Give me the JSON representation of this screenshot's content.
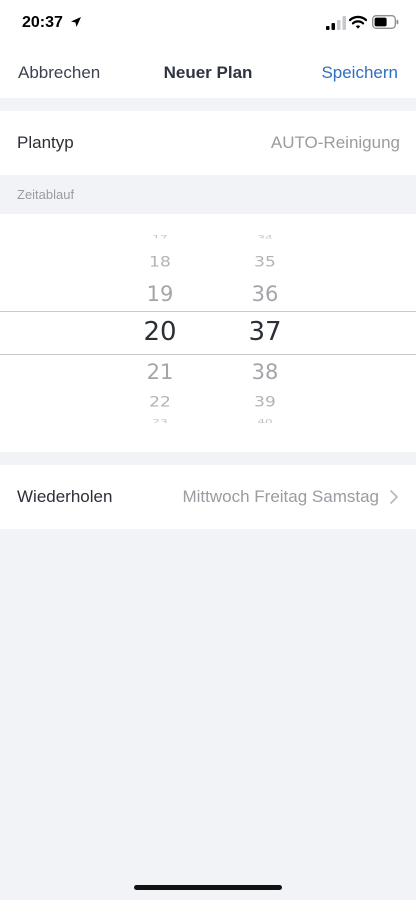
{
  "status": {
    "time": "20:37"
  },
  "nav": {
    "cancel": "Abbrechen",
    "title": "Neuer Plan",
    "save": "Speichern"
  },
  "plan_type": {
    "label": "Plantyp",
    "value": "AUTO-Reinigung"
  },
  "section": {
    "timeline": "Zeitablauf"
  },
  "picker": {
    "hours": [
      "17",
      "18",
      "19",
      "20",
      "21",
      "22",
      "23"
    ],
    "minutes": [
      "34",
      "35",
      "36",
      "37",
      "38",
      "39",
      "40"
    ],
    "selected_hour": "20",
    "selected_minute": "37"
  },
  "repeat": {
    "label": "Wiederholen",
    "value": "Mittwoch Freitag Samstag"
  },
  "colors": {
    "accent": "#2f6fc2",
    "background": "#f2f3f7"
  }
}
